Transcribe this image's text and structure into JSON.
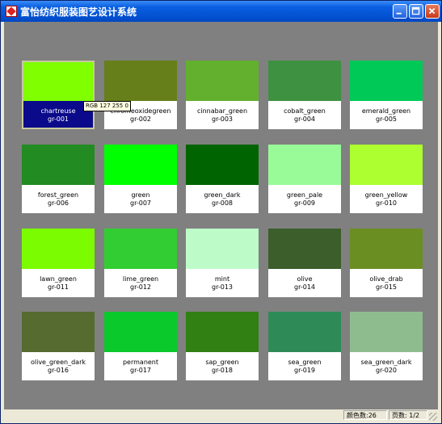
{
  "window": {
    "title": "富怡纺织服装图艺设计系统",
    "icon": "app-icon",
    "buttons": [
      {
        "name": "minimize",
        "icon": "minimize-icon"
      },
      {
        "name": "maximize",
        "icon": "maximize-icon"
      },
      {
        "name": "close",
        "icon": "close-icon"
      }
    ]
  },
  "tooltip": "RGB 127 255 0",
  "tiles": [
    {
      "name": "chartreuse",
      "code": "gr-001",
      "color": "#7FFF00",
      "selected": true
    },
    {
      "name": "chromeoxidegreen",
      "code": "gr-002",
      "color": "#667F1A"
    },
    {
      "name": "cinnabar_green",
      "code": "gr-003",
      "color": "#63B02E"
    },
    {
      "name": "cobalt_green",
      "code": "gr-004",
      "color": "#3D9140"
    },
    {
      "name": "emerald_green",
      "code": "gr-005",
      "color": "#00C957"
    },
    {
      "name": "forest_green",
      "code": "gr-006",
      "color": "#228B22"
    },
    {
      "name": "green",
      "code": "gr-007",
      "color": "#00FF00"
    },
    {
      "name": "green_dark",
      "code": "gr-008",
      "color": "#006400"
    },
    {
      "name": "green_pale",
      "code": "gr-009",
      "color": "#98FB98"
    },
    {
      "name": "green_yellow",
      "code": "gr-010",
      "color": "#ADFF2F"
    },
    {
      "name": "lawn_green",
      "code": "gr-011",
      "color": "#7CFC00"
    },
    {
      "name": "lime_green",
      "code": "gr-012",
      "color": "#32CD32"
    },
    {
      "name": "mint",
      "code": "gr-013",
      "color": "#BDFCC9"
    },
    {
      "name": "olive",
      "code": "gr-014",
      "color": "#3B5E2B"
    },
    {
      "name": "olive_drab",
      "code": "gr-015",
      "color": "#6B8E23"
    },
    {
      "name": "olive_green_dark",
      "code": "gr-016",
      "color": "#556B2F"
    },
    {
      "name": "permanent",
      "code": "gr-017",
      "color": "#0AC92B"
    },
    {
      "name": "sap_green",
      "code": "gr-018",
      "color": "#308014"
    },
    {
      "name": "sea_green",
      "code": "gr-019",
      "color": "#2E8B57"
    },
    {
      "name": "sea_green_dark",
      "code": "gr-020",
      "color": "#8FBC8F"
    }
  ],
  "status": {
    "color_count": "颜色数:26",
    "page": "页数: 1/2"
  }
}
